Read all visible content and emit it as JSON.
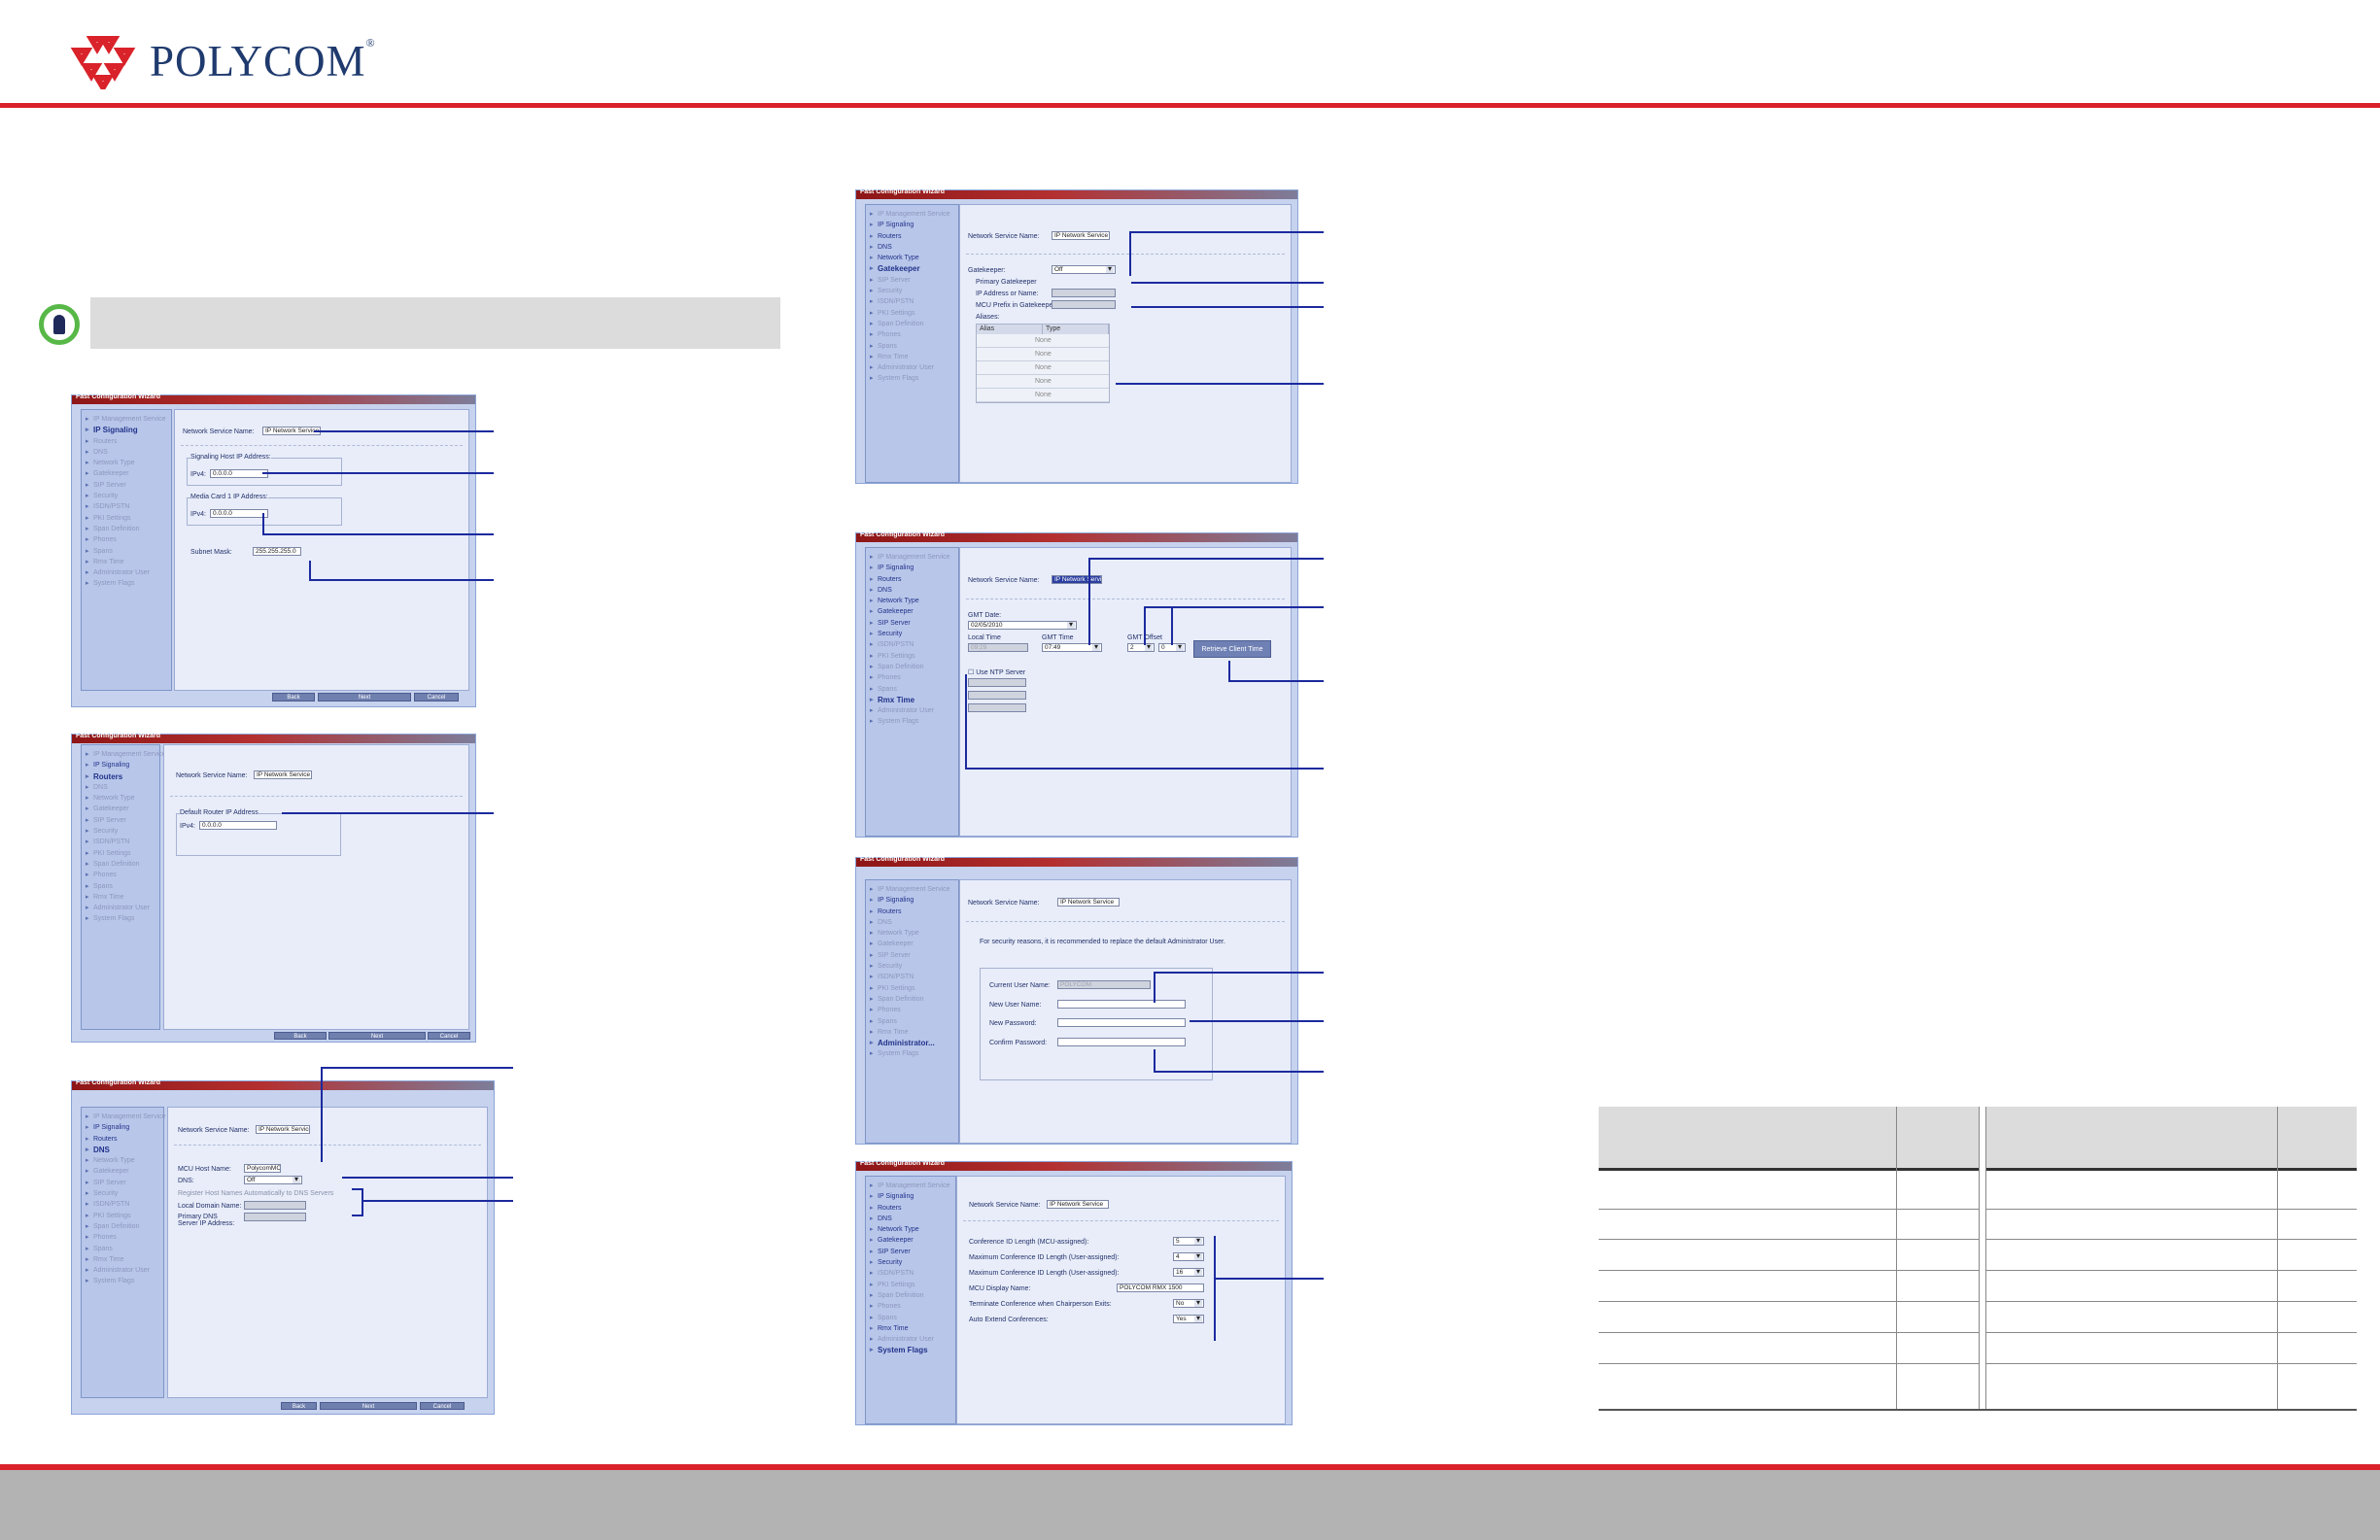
{
  "brand": {
    "name": "POLYCOM",
    "reg": "®",
    "color": "#d9222a",
    "text_color": "#1f3a6e"
  },
  "wizard_title": "Fast Configuration Wizard",
  "nav": {
    "ip_mgmt": "IP Management Service",
    "ip_signaling": "IP Signaling",
    "routers": "Routers",
    "dns": "DNS",
    "network_type": "Network Type",
    "gatekeeper": "Gatekeeper",
    "sip_server": "SIP Server",
    "security": "Security",
    "isdn": "ISDN/PSTN",
    "pki": "PKI Settings",
    "span_def": "Span Definition",
    "phones": "Phones",
    "spans": "Spans",
    "rmx_time": "Rmx Time",
    "admin_user": "Administrator User",
    "admin_user_short": "Administrator...",
    "system_flags": "System Flags"
  },
  "fields": {
    "network_service_name_label": "Network Service Name:",
    "network_service_name_value": "IP Network Service",
    "signaling_host_ip_label": "Signaling Host IP Address:",
    "ipv4_label": "IPv4:",
    "ip_zero": "0.0.0.0",
    "media_card_ip_label": "Media Card 1 IP Address:",
    "subnet_mask_label": "Subnet Mask:",
    "subnet_mask_value": "255.255.255.0",
    "default_router_label": "Default Router IP Address",
    "mcu_host_name_label": "MCU Host Name:",
    "mcu_host_name_value": "PolycomMCU",
    "dns_label": "DNS:",
    "off_value": "Off",
    "register_host_names": "Register Host Names Automatically to DNS Servers",
    "local_domain_label": "Local Domain Name:",
    "primary_dns_label": "Primary DNS Server IP Address:",
    "gatekeeper_label": "Gatekeeper:",
    "primary_gatekeeper_label": "Primary Gatekeeper",
    "gk_ip_label": "IP Address or Name:",
    "mcu_prefix_label": "MCU Prefix in Gatekeeper:",
    "aliases_label": "Aliases:",
    "alias_col": "Alias",
    "type_col": "Type",
    "none_value": "None",
    "gmt_date_label": "GMT Date:",
    "gmt_date_value": "02/05/2010",
    "local_time_label": "Local Time",
    "local_time_value": "09:29",
    "gmt_time_label": "GMT Time",
    "gmt_time_value": "07:49",
    "gmt_offset_label": "GMT Offset",
    "gmt_offset_h": "2",
    "gmt_offset_m": "0",
    "retrieve_client_time": "Retrieve Client Time",
    "use_ntp_label": "Use NTP Server",
    "security_reason_text": "For security reasons, it is recommended to replace the default Administrator User.",
    "current_user_label": "Current User Name:",
    "current_user_value": "POLYCOM",
    "new_user_label": "New User Name:",
    "new_password_label": "New Password:",
    "confirm_password_label": "Confirm Password:",
    "conf_id_mcu_label": "Conference ID Length (MCU-assigned):",
    "conf_id_mcu_value": "5",
    "max_conf_id_label": "Maximum Conference ID Length (User-assigned):",
    "max_conf_id_value": "4",
    "max_conf_id2_label": "Maximum Conference ID Length (User-assigned):",
    "max_conf_id2_value": "16",
    "mcu_display_label": "MCU Display Name:",
    "mcu_display_value": "POLYCOM RMX 1500",
    "terminate_label": "Terminate Conference when Chairperson Exits:",
    "terminate_value": "No",
    "auto_extend_label": "Auto Extend Conferences:",
    "auto_extend_value": "Yes"
  },
  "buttons": {
    "back": "Back",
    "next": "Next",
    "cancel": "Cancel"
  },
  "colors": {
    "leader_line": "#1c2a9e",
    "note_icon": "#57b848"
  }
}
